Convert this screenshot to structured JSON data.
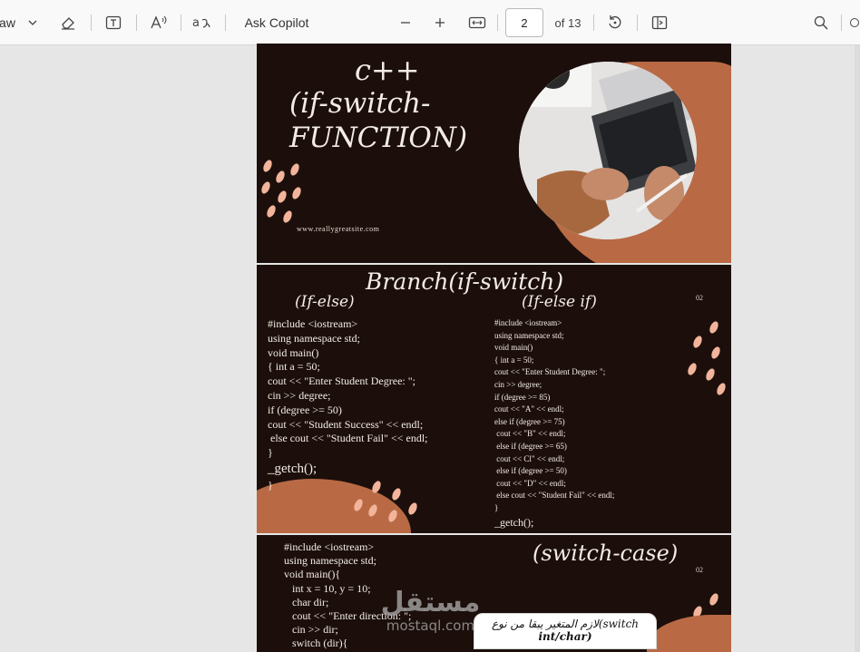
{
  "toolbar": {
    "draw_label": "aw",
    "ask_copilot": "Ask Copilot",
    "page_number": "2",
    "page_total": "of 13"
  },
  "slide1": {
    "title_line1": "c++",
    "title_line2": "(if-switch-",
    "title_line3": "FUNCTION)",
    "website": "www.reallygreatsite.com"
  },
  "slide2": {
    "title": "Branch(if-switch)",
    "left_heading": "(If-else)",
    "right_heading": "(If-else if)",
    "page_num": "02",
    "left_code": [
      "#include <iostream>",
      "using namespace std;",
      "void main()",
      "{ int a = 50;",
      "cout << \"Enter Student Degree: \";",
      "cin >> degree;",
      "if (degree >= 50)",
      "cout << \"Student Success\" << endl;",
      " else cout << \"Student Fail\" << endl;",
      "}",
      "_getch();",
      "}"
    ],
    "right_code": [
      "#include <iostream>",
      "using namespace std;",
      "void main()",
      "{ int a = 50;",
      "cout << \"Enter Student Degree: \";",
      "cin >> degree;",
      "if (degree >= 85)",
      "cout << \"A\" << endl;",
      "else if (degree >= 75)",
      " cout << \"B\" << endl;",
      " else if (degree >= 65)",
      " cout << Cl\" << endl;",
      " else if (degree >= 50)",
      " cout << \"D\" << endl;",
      " else cout << \"Student Fail\" << endl;",
      "}",
      "_getch();"
    ]
  },
  "slide3": {
    "title": "(switch-case)",
    "page_num": "02",
    "code": [
      "#include <iostream>",
      "using namespace std;",
      "void main(){",
      "   int x = 10, y = 10;",
      "   char dir;",
      "   cout << \"Enter direction: \";",
      "   cin >> dir;",
      "   switch (dir){"
    ]
  },
  "watermark": {
    "arabic": "مستقل",
    "domain": "mostaql.com"
  },
  "tooltip": {
    "line1": "لازم المتغير يبقا من نوع(switch",
    "line2": "int/char)"
  }
}
